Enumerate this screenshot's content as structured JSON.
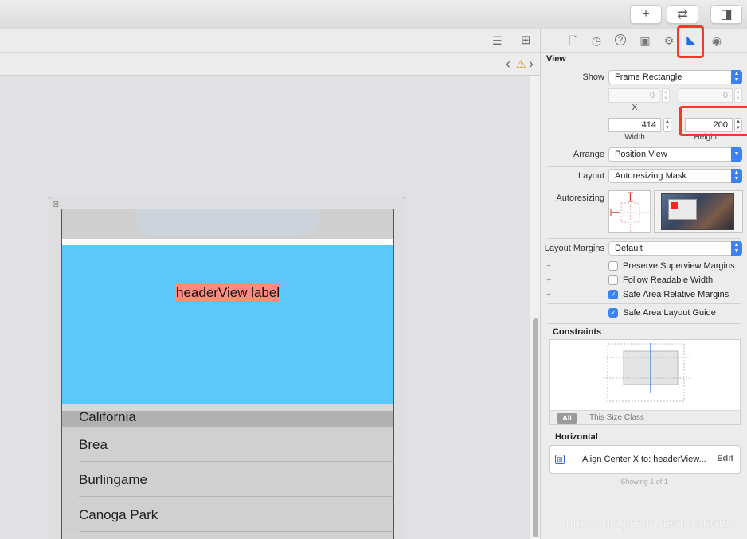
{
  "toolbar": {
    "add_glyph": "+",
    "swap_glyph": "⇄",
    "panel_glyph": "◨"
  },
  "editor": {
    "lines_glyph": "☰",
    "add_editor_glyph": "⊞",
    "nav_back": "‹",
    "nav_forward": "›",
    "warning_glyph": "⚠"
  },
  "scene": {
    "close_glyph": "⊠",
    "header_label": "headerView label",
    "section_title": "California",
    "cells": [
      "Brea",
      "Burlingame",
      "Canoga Park"
    ],
    "header_color": "#5ac8fa",
    "label_bg_color": "#ff8a80"
  },
  "inspector": {
    "tab_glyphs": {
      "file": "🗋",
      "history": "◷",
      "help": "?",
      "identity": "▣",
      "attributes": "⚙",
      "size": "◣",
      "connections": "◉"
    },
    "view_section": "View",
    "show_label": "Show",
    "show_value": "Frame Rectangle",
    "x_value": "0",
    "y_value": "0",
    "x_label": "X",
    "width_value": "414",
    "height_value": "200",
    "width_label": "Width",
    "height_label": "Height",
    "arrange_label": "Arrange",
    "arrange_value": "Position View",
    "layout_label": "Layout",
    "layout_value": "Autoresizing Mask",
    "autoresizing_label": "Autoresizing",
    "layout_margins_label": "Layout Margins",
    "layout_margins_value": "Default",
    "preserve_label": "Preserve Superview Margins",
    "follow_label": "Follow Readable Width",
    "safe_area_margins_label": "Safe Area Relative Margins",
    "safe_area_guide_label": "Safe Area Layout Guide",
    "plus_glyph": "+",
    "check_glyph": "✓",
    "constraints_title": "Constraints",
    "all_pill": "All",
    "size_class": "This Size Class",
    "horizontal_title": "Horizontal",
    "constraint_text": "Align Center X to:  headerView...",
    "edit_label": "Edit",
    "showing": "Showing 1 of 1",
    "highlight_color": "#f23a2a",
    "accent_color": "#3a82f7"
  },
  "watermark": "https://blog.csdn.net/boildoctor"
}
